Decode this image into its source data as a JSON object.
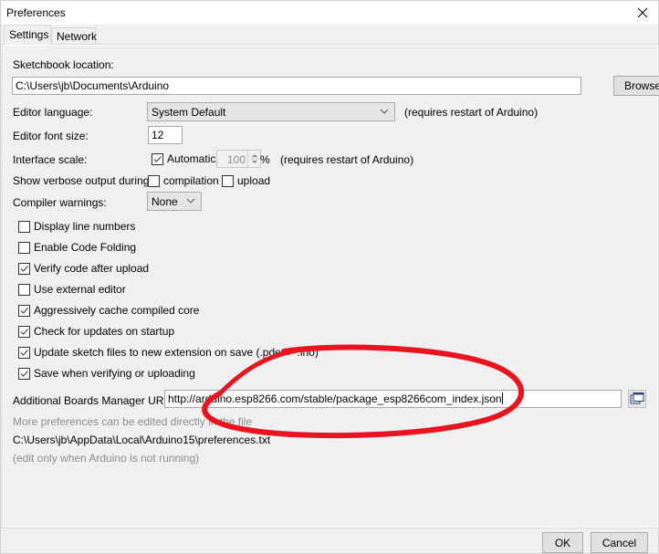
{
  "window": {
    "title": "Preferences"
  },
  "tabs": [
    {
      "label": "Settings",
      "active": true
    },
    {
      "label": "Network",
      "active": false
    }
  ],
  "settings": {
    "sketchbook": {
      "label": "Sketchbook location:",
      "value": "C:\\Users\\jb\\Documents\\Arduino",
      "browse_label": "Browse"
    },
    "editor_language": {
      "label": "Editor language:",
      "value": "System Default",
      "note": "(requires restart of Arduino)"
    },
    "editor_font_size": {
      "label": "Editor font size:",
      "value": "12"
    },
    "interface_scale": {
      "label": "Interface scale:",
      "automatic_label": "Automatic",
      "automatic_checked": true,
      "value": "100",
      "unit": "%",
      "note": "(requires restart of Arduino)"
    },
    "verbose_output": {
      "label": "Show verbose output during:",
      "compilation_label": "compilation",
      "compilation_checked": false,
      "upload_label": "upload",
      "upload_checked": false
    },
    "compiler_warnings": {
      "label": "Compiler warnings:",
      "value": "None"
    },
    "checkboxes": [
      {
        "label": "Display line numbers",
        "checked": false
      },
      {
        "label": "Enable Code Folding",
        "checked": false
      },
      {
        "label": "Verify code after upload",
        "checked": true
      },
      {
        "label": "Use external editor",
        "checked": false
      },
      {
        "label": "Aggressively cache compiled core",
        "checked": true
      },
      {
        "label": "Check for updates on startup",
        "checked": true
      },
      {
        "label": "Update sketch files to new extension on save (.pde -> .ino)",
        "checked": true
      },
      {
        "label": "Save when verifying or uploading",
        "checked": true
      }
    ],
    "boards_manager": {
      "label": "Additional Boards Manager URLs:",
      "value": "http://arduino.esp8266.com/stable/package_esp8266com_index.json"
    },
    "more_prefs_note": "More preferences can be edited directly in the file",
    "prefs_path": "C:\\Users\\jb\\AppData\\Local\\Arduino15\\preferences.txt",
    "edit_note": "(edit only when Arduino is not running)"
  },
  "footer": {
    "ok_label": "OK",
    "cancel_label": "Cancel"
  },
  "annotation": {
    "color": "#e8141f"
  }
}
